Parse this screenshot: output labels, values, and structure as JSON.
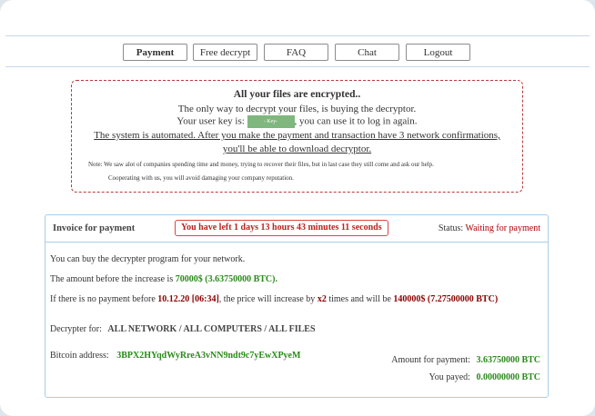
{
  "nav": {
    "items": [
      {
        "label": "Payment"
      },
      {
        "label": "Free decrypt"
      },
      {
        "label": "FAQ"
      },
      {
        "label": "Chat"
      },
      {
        "label": "Logout"
      }
    ]
  },
  "notice": {
    "line1": "All your files are encrypted..",
    "line2": "The only way to decrypt your files, is buying the decryptor.",
    "line3_prefix": "Your user key is:",
    "key_placeholder": "- Key-",
    "line3_suffix": ", you can use it to log in again.",
    "line4": "The system is automated. After you make the payment and transaction have 3 network confirmations,",
    "line5": "you'll be able to download decryptor.",
    "note1": "Note: We saw alot of companies spending time and money, trying to recover their files, but in last case they still come and ask our help.",
    "note2": "Cooperating with us, you will avoid damaging your company reputation."
  },
  "invoice": {
    "title": "Invoice for payment",
    "timer": "You have left 1 days 13 hours 43 minutes 11 seconds",
    "status_label": "Status:",
    "status_value": "Waiting for payment",
    "line1": "You can buy the decrypter program for your network.",
    "line2_prefix": "The amount before the increase is",
    "line2_amount": "70000$",
    "line2_btc": "(3.63750000 BTC).",
    "line3_prefix": "If there is no payment before",
    "line3_date": "10.12.20 [06:34]",
    "line3_mid": ", the price will increase by",
    "line3_factor": "x2",
    "line3_mid2": "times and will be",
    "line3_amount": "140000$",
    "line3_btc": "(7.27500000 BTC)",
    "decryptor_label": "Decrypter for:",
    "decryptor_value": "ALL NETWORK / ALL COMPUTERS / ALL FILES",
    "bitcoin_label": "Bitcoin address:",
    "bitcoin_value": "3BPX2HYqdWyRreA3vNN9ndt9c7yEwXPyeM",
    "amount_label": "Amount for payment:",
    "amount_value": "3.63750000 BTC",
    "payed_label": "You payed:",
    "payed_value": "0.00000000 BTC"
  },
  "colors": {
    "accent_red": "#c02020",
    "accent_green": "#2a8a1a",
    "border_blue": "#a9cde9"
  }
}
